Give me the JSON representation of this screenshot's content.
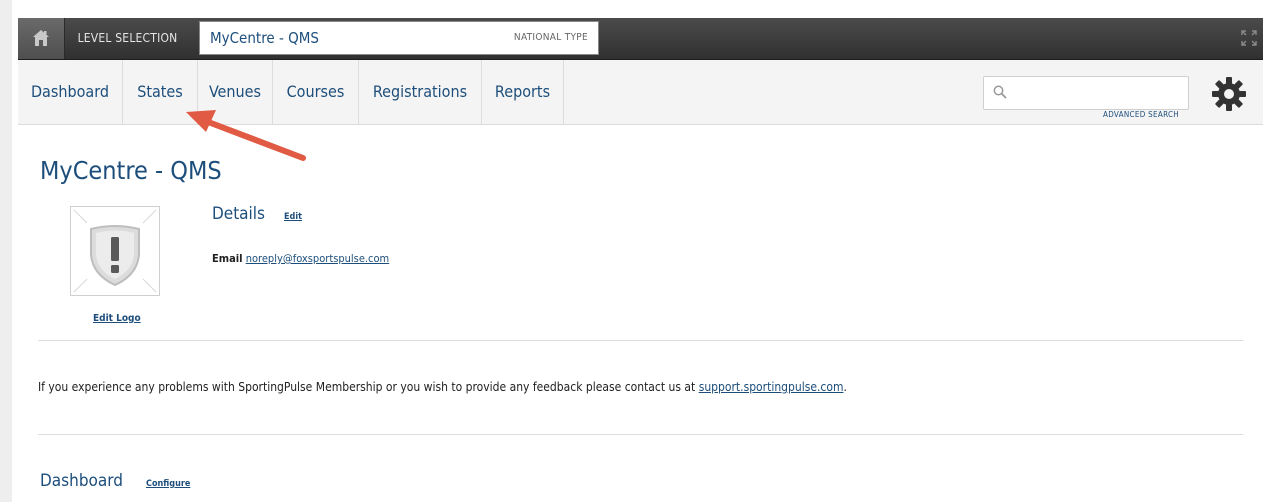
{
  "level_bar": {
    "level_selection_label": "LEVEL SELECTION",
    "current_level_name": "MyCentre - QMS",
    "level_type": "NATIONAL TYPE",
    "home_icon": "home-icon",
    "expand_icon": "expand-icon"
  },
  "nav": {
    "tabs": [
      {
        "label": "Dashboard"
      },
      {
        "label": "States"
      },
      {
        "label": "Venues"
      },
      {
        "label": "Courses"
      },
      {
        "label": "Registrations"
      },
      {
        "label": "Reports"
      }
    ],
    "search_placeholder": "",
    "advanced_search_label": "ADVANCED SEARCH",
    "settings_icon": "gear-icon"
  },
  "main": {
    "title": "MyCentre - QMS",
    "edit_logo_label": "Edit Logo",
    "details": {
      "heading": "Details",
      "edit_label": "Edit",
      "email_label": "Email",
      "email_value": "noreply@foxsportspulse.com"
    },
    "feedback_text": "If you experience any problems with SportingPulse Membership or you wish to provide any feedback please contact us at ",
    "feedback_link": "support.sportingpulse.com",
    "feedback_end": ".",
    "dashboard": {
      "heading": "Dashboard",
      "configure_label": "Configure"
    }
  },
  "colors": {
    "link_blue": "#1d4e7b",
    "top_bar": "#3a3a3a",
    "nav_bg": "#f4f4f4",
    "annotation_arrow": "#e05a44"
  }
}
